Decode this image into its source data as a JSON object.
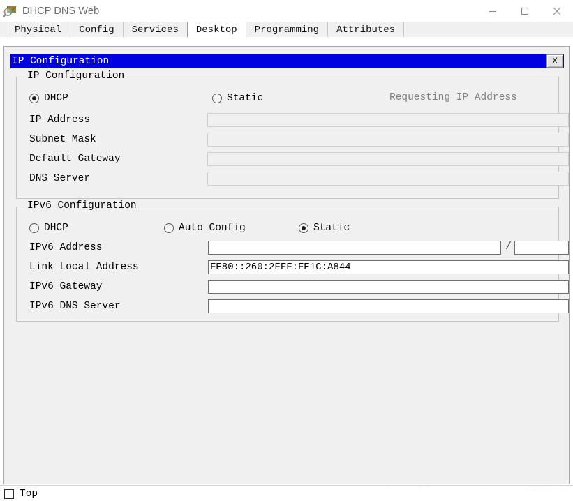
{
  "window": {
    "title": "DHCP DNS Web",
    "icon": "packet-tracer-device-icon",
    "controls": {
      "minimize": "—",
      "maximize": "□",
      "close": "✕"
    }
  },
  "tabs": [
    {
      "label": "Physical",
      "active": false
    },
    {
      "label": "Config",
      "active": false
    },
    {
      "label": "Services",
      "active": false
    },
    {
      "label": "Desktop",
      "active": true
    },
    {
      "label": "Programming",
      "active": false
    },
    {
      "label": "Attributes",
      "active": false
    }
  ],
  "inner_window": {
    "title": "IP Configuration",
    "close_label": "X",
    "titlebar_color": "#0000e0"
  },
  "ip_configuration": {
    "legend": "IP Configuration",
    "mode_options": [
      {
        "label": "DHCP",
        "selected": true
      },
      {
        "label": "Static",
        "selected": false
      }
    ],
    "status": "Requesting IP Address",
    "fields": [
      {
        "label": "IP Address",
        "value": "",
        "enabled": false
      },
      {
        "label": "Subnet Mask",
        "value": "",
        "enabled": false
      },
      {
        "label": "Default Gateway",
        "value": "",
        "enabled": false
      },
      {
        "label": "DNS Server",
        "value": "",
        "enabled": false
      }
    ]
  },
  "ipv6_configuration": {
    "legend": "IPv6 Configuration",
    "mode_options": [
      {
        "label": "DHCP",
        "selected": false
      },
      {
        "label": "Auto Config",
        "selected": false
      },
      {
        "label": "Static",
        "selected": true
      }
    ],
    "address": {
      "label": "IPv6 Address",
      "value": "",
      "prefix_separator": "/",
      "prefix_value": ""
    },
    "fields": [
      {
        "label": "Link Local Address",
        "value": "FE80::260:2FFF:FE1C:A844",
        "enabled": true
      },
      {
        "label": "IPv6 Gateway",
        "value": "",
        "enabled": true
      },
      {
        "label": "IPv6 DNS Server",
        "value": "",
        "enabled": true
      }
    ]
  },
  "footer": {
    "top_checkbox": {
      "label": "Top",
      "checked": false
    },
    "watermark": "https://blog.csdn.net/weixin_47357131"
  }
}
